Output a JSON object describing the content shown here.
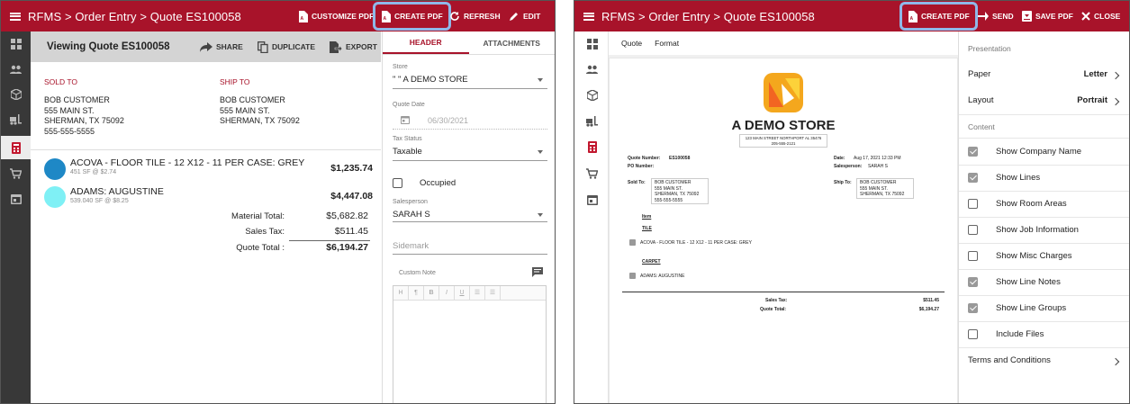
{
  "left": {
    "breadcrumb": "RFMS > Order Entry > Quote ES100058",
    "toolbar": {
      "customize_pdf": "CUSTOMIZE PDF",
      "create_pdf": "CREATE PDF",
      "refresh": "REFRESH",
      "edit": "EDIT"
    },
    "subheader": {
      "title": "Viewing Quote ES100058",
      "share": "SHARE",
      "duplicate": "DUPLICATE",
      "export": "EXPORT"
    },
    "sold_to": {
      "label": "SOLD TO",
      "lines": [
        "BOB CUSTOMER",
        "555 MAIN ST.",
        "SHERMAN, TX 75092",
        "555-555-5555"
      ]
    },
    "ship_to": {
      "label": "SHIP TO",
      "lines": [
        "BOB CUSTOMER",
        "555 MAIN ST.",
        "SHERMAN, TX 75092"
      ]
    },
    "lines": [
      {
        "name": "ACOVA - FLOOR TILE - 12 X12 - 11 PER CASE: GREY",
        "sub": "451 SF @ $2.74",
        "amount": "$1,235.74",
        "color": "#1e88c6"
      },
      {
        "name": "ADAMS: AUGUSTINE",
        "sub": "539.040 SF @ $8.25",
        "amount": "$4,447.08",
        "color": "#7ff0f5"
      }
    ],
    "totals": {
      "material_label": "Material Total:",
      "material": "$5,682.82",
      "tax_label": "Sales Tax:",
      "tax": "$511.45",
      "quote_label": "Quote Total :",
      "quote": "$6,194.27"
    },
    "tabs": {
      "header": "HEADER",
      "attachments": "ATTACHMENTS"
    },
    "fields": {
      "store_label": "Store",
      "store": "\" \" A DEMO STORE",
      "date_label": "Quote Date",
      "date": "06/30/2021",
      "tax_status_label": "Tax Status",
      "tax_status": "Taxable",
      "occupied": "Occupied",
      "salesperson_label": "Salesperson",
      "salesperson": "SARAH S",
      "sidemark_placeholder": "Sidemark",
      "custom_note_label": "Custom Note"
    },
    "editor_tools": [
      "H",
      "¶",
      "B",
      "I",
      "U",
      "☰",
      "☰"
    ]
  },
  "right": {
    "breadcrumb": "RFMS > Order Entry > Quote ES100058",
    "toolbar": {
      "create_pdf": "CREATE PDF",
      "send": "SEND",
      "save_pdf": "SAVE PDF",
      "close": "CLOSE"
    },
    "tabs": {
      "quote": "Quote",
      "format": "Format"
    },
    "doc": {
      "store_name": "A DEMO STORE",
      "address": "123 MAIN STREET NORTHPORT AL 35476",
      "phone": "205-555-2121",
      "quote_number_label": "Quote Number:",
      "quote_number": "ES100058",
      "po_number_label": "PO Number:",
      "date_label": "Date:",
      "date": "Aug 17, 2021 12:33 PM",
      "salesperson_label": "Salesperson:",
      "salesperson": "SARAH S",
      "sold_to_label": "Sold To:",
      "sold_to": [
        "BOB CUSTOMER",
        "555 MAIN ST.",
        "SHERMAN, TX 75092",
        "555-555-5555"
      ],
      "ship_to_label": "Ship To:",
      "ship_to": [
        "BOB CUSTOMER",
        "555 MAIN ST.",
        "SHERMAN, TX 75092"
      ],
      "item_header": "Item",
      "group1": "TILE",
      "item1": "ACOVA - FLOOR TILE - 12 X12 - 11 PER CASE: GREY",
      "group2": "CARPET",
      "item2": "ADAMS: AUGUSTINE",
      "sales_tax_label": "Sales Tax:",
      "sales_tax": "$511.45",
      "quote_total_label": "Quote Total:",
      "quote_total": "$6,194.27"
    },
    "options": {
      "presentation": "Presentation",
      "paper_label": "Paper",
      "paper": "Letter",
      "layout_label": "Layout",
      "layout": "Portrait",
      "content": "Content",
      "checks": [
        {
          "label": "Show Company Name",
          "checked": true
        },
        {
          "label": "Show Lines",
          "checked": true
        },
        {
          "label": "Show Room Areas",
          "checked": false
        },
        {
          "label": "Show Job Information",
          "checked": false
        },
        {
          "label": "Show Misc Charges",
          "checked": false
        },
        {
          "label": "Show Line Notes",
          "checked": true
        },
        {
          "label": "Show Line Groups",
          "checked": true
        },
        {
          "label": "Include Files",
          "checked": false
        }
      ],
      "terms": "Terms and Conditions"
    }
  }
}
